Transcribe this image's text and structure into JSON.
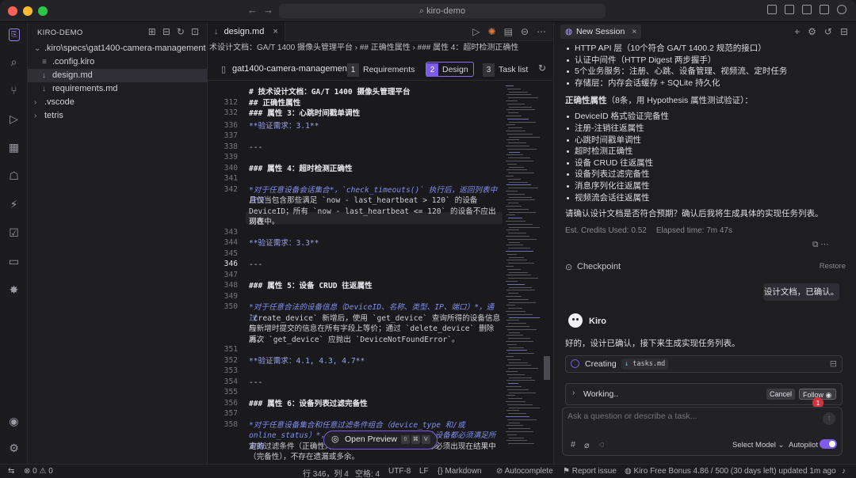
{
  "titlebar": {
    "search": "kiro-demo"
  },
  "explorer": {
    "title": "KIRO-DEMO",
    "items": [
      {
        "label": ".kiro\\specs\\gat1400-camera-management",
        "indent": 0,
        "arrow": "⌄"
      },
      {
        "label": ".config.kiro",
        "indent": 1,
        "arrow": ""
      },
      {
        "label": "design.md",
        "indent": 1,
        "arrow": ""
      },
      {
        "label": "requirements.md",
        "indent": 1,
        "arrow": ""
      },
      {
        "label": ".vscode",
        "indent": 0,
        "arrow": "›"
      },
      {
        "label": "tetris",
        "indent": 0,
        "arrow": "›"
      }
    ]
  },
  "editor": {
    "tab_label": "design.md",
    "breadcrumb": "术设计文档：GA/T 1400 摄像头管理平台 › ## 正确性属性 › ### 属性 4：超时检测正确性",
    "spec_name": "gat1400-camera-management",
    "steps": [
      {
        "n": "1",
        "label": "Requirements"
      },
      {
        "n": "2",
        "label": "Design"
      },
      {
        "n": "3",
        "label": "Task list"
      }
    ],
    "sticky": [
      {
        "ln": "",
        "text": "# 技术设计文档：GA/T 1400 摄像头管理平台"
      },
      {
        "ln": "312",
        "text": "## 正确性属性"
      },
      {
        "ln": "332",
        "text": "### 属性 3：心跳时间戳单调性"
      }
    ],
    "lines": [
      {
        "ln": "336",
        "text": "**验证需求：3.1**",
        "cls": "bo"
      },
      {
        "ln": "337",
        "text": "",
        "cls": ""
      },
      {
        "ln": "338",
        "text": "---",
        "cls": ""
      },
      {
        "ln": "339",
        "text": "",
        "cls": ""
      },
      {
        "ln": "340",
        "text": "### 属性 4：超时检测正确性",
        "cls": "h"
      },
      {
        "ln": "341",
        "text": "",
        "cls": ""
      },
      {
        "ln": "342",
        "text": "*对于任意设备会话集合*，`check_timeouts()` 执行后，返回列表中应当",
        "cls": "mix1"
      },
      {
        "ln": "",
        "text": "且仅当包含那些满足 `now - last_heartbeat > 120` 的设备",
        "cls": ""
      },
      {
        "ln": "",
        "text": "DeviceID；所有 `now - last_heartbeat <= 120` 的设备不应出现在",
        "cls": ""
      },
      {
        "ln": "",
        "text": "列表中。",
        "cls": ""
      },
      {
        "ln": "343",
        "text": "",
        "cls": ""
      },
      {
        "ln": "344",
        "text": "**验证需求：3.3**",
        "cls": "bo"
      },
      {
        "ln": "345",
        "text": "",
        "cls": ""
      },
      {
        "ln": "346",
        "text": "---",
        "cls": ""
      },
      {
        "ln": "347",
        "text": "",
        "cls": ""
      },
      {
        "ln": "348",
        "text": "### 属性 5：设备 CRUD 往返属性",
        "cls": "h"
      },
      {
        "ln": "349",
        "text": "",
        "cls": ""
      },
      {
        "ln": "350",
        "text": "*对于任意合法的设备信息（DeviceID、名称、类型、IP、端口）*，通过",
        "cls": "mix1"
      },
      {
        "ln": "",
        "text": "`create_device` 新增后，使用 `get_device` 查询所得的设备信息应",
        "cls": ""
      },
      {
        "ln": "",
        "text": "与新增时提交的信息在所有字段上等价；通过 `delete_device` 删除后，",
        "cls": ""
      },
      {
        "ln": "",
        "text": "再次 `get_device` 应抛出 `DeviceNotFoundError`。",
        "cls": ""
      },
      {
        "ln": "351",
        "text": "",
        "cls": ""
      },
      {
        "ln": "352",
        "text": "**验证需求：4.1, 4.3, 4.7**",
        "cls": "bo"
      },
      {
        "ln": "353",
        "text": "",
        "cls": ""
      },
      {
        "ln": "354",
        "text": "---",
        "cls": ""
      },
      {
        "ln": "355",
        "text": "",
        "cls": ""
      },
      {
        "ln": "356",
        "text": "### 属性 6：设备列表过滤完备性",
        "cls": "h"
      },
      {
        "ln": "357",
        "text": "",
        "cls": ""
      },
      {
        "ln": "358",
        "text": "*对于任意设备集合和任意过滤条件组合（device_type 和/或",
        "cls": "it"
      },
      {
        "ln": "",
        "text": "online_status）*，`list_devices` 返回的每个设备都必须满足所有指",
        "cls": "mix2"
      },
      {
        "ln": "",
        "text": "定的过滤条件（正确性），且所有满足过滤条件的设备都必须出现在结果中",
        "cls": ""
      },
      {
        "ln": "",
        "text": "（完备性），不存在遗漏或多余。",
        "cls": ""
      },
      {
        "ln": "359",
        "text": "",
        "cls": ""
      }
    ],
    "preview_label": "Open Preview",
    "preview_keys": [
      "⇧",
      "⌘",
      "V"
    ]
  },
  "chat": {
    "session_tab": "New Session",
    "bullets_top": [
      "HTTP API 层（10个符合 GA/T 1400.2 规范的接口）",
      "认证中间件（HTTP Digest 两步握手）",
      "5个业务服务：注册、心跳、设备管理、视频流、定时任务",
      "存储层：内存会话缓存 + SQLite 持久化"
    ],
    "props_heading_bold": "正确性属性",
    "props_heading_rest": "（8条，用 Hypothesis 属性测试验证）：",
    "props": [
      "DeviceID 格式验证完备性",
      "注册-注销往返属性",
      "心跳时间戳单调性",
      "超时检测正确性",
      "设备 CRUD 往返属性",
      "设备列表过滤完备性",
      "消息序列化往返属性",
      "视频流会话往返属性"
    ],
    "question": "请确认设计文档是否符合预期？确认后我将生成具体的实现任务列表。",
    "credits": "Est. Credits Used: 0.52",
    "elapsed": "Elapsed time: 7m 47s",
    "checkpoint": "Checkpoint",
    "restore": "Restore",
    "user_message": "设计文档，已确认。",
    "agent_name": "Kiro",
    "agent_reply": "好的，设计已确认，接下来生成实现任务列表。",
    "creating_label": "Creating",
    "creating_file": "tasks.md",
    "working_label": "Working..",
    "cancel_label": "Cancel",
    "follow_label": "Follow",
    "badge_count": "1",
    "input_placeholder": "Ask a question or describe a task...",
    "model_label": "Select Model",
    "autopilot_label": "Autopilot",
    "autopilot_on": true
  },
  "statusbar": {
    "errors": "0",
    "warnings": "0",
    "position": "行 346，列 4",
    "spaces": "空格: 4",
    "encoding": "UTF-8",
    "eol": "LF",
    "language": "Markdown",
    "autocomplete": "Autocomplete",
    "report": "Report issue",
    "bonus": "Kiro Free Bonus 4.86 / 500 (30 days left) updated 1m ago"
  }
}
